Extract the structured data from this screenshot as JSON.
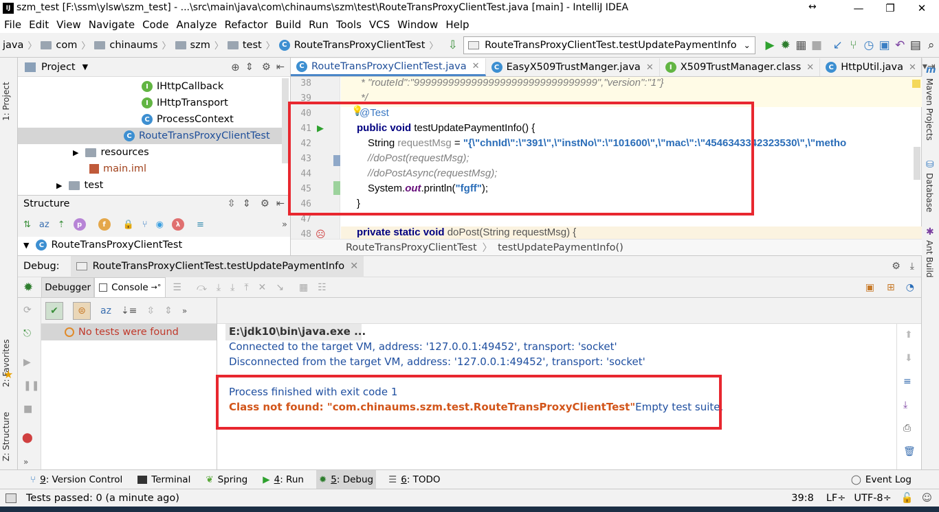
{
  "window": {
    "title": "szm_test [F:\\ssm\\ylsw\\szm_test] - ...\\src\\main\\java\\com\\chinaums\\szm\\test\\RouteTransProxyClientTest.java [main] - IntelliJ IDEA"
  },
  "menu": [
    "File",
    "Edit",
    "View",
    "Navigate",
    "Code",
    "Analyze",
    "Refactor",
    "Build",
    "Run",
    "Tools",
    "VCS",
    "Window",
    "Help"
  ],
  "breadcrumbs": [
    "java",
    "com",
    "chinaums",
    "szm",
    "test",
    "RouteTransProxyClientTest"
  ],
  "run_config": "RouteTransProxyClientTest.testUpdatePaymentInfo",
  "project": {
    "title": "Project",
    "items": [
      {
        "label": "IHttpCallback",
        "kind": "I"
      },
      {
        "label": "IHttpTransport",
        "kind": "I"
      },
      {
        "label": "ProcessContext",
        "kind": "C"
      },
      {
        "label": "RouteTransProxyClientTest",
        "kind": "C"
      },
      {
        "label": "resources",
        "kind": "folder"
      },
      {
        "label": "main.iml",
        "kind": "iml"
      },
      {
        "label": "test",
        "kind": "folder"
      }
    ]
  },
  "structure": {
    "title": "Structure",
    "root": "RouteTransProxyClientTest"
  },
  "editor": {
    "tabs": [
      {
        "label": "RouteTransProxyClientTest.java",
        "icon": "C"
      },
      {
        "label": "EasyX509TrustManger.java",
        "icon": "C"
      },
      {
        "label": "X509TrustManager.class",
        "icon": "I"
      },
      {
        "label": "HttpUtil.java",
        "icon": "C"
      }
    ],
    "line_numbers": [
      "38",
      "39",
      "40",
      "41",
      "42",
      "43",
      "44",
      "45",
      "46",
      "47",
      "48"
    ],
    "code": {
      "l38": "* \"routeId\":\"99999999999999999999999999999999\",\"version\":\"1\"}",
      "l39": "*/",
      "l40": "@Test",
      "l41_kw": "public void",
      "l41_rest": " testUpdatePaymentInfo() {",
      "l42_type": "String ",
      "l42_var": "requestMsg",
      "l42_eq": " = ",
      "l42_str": "\"{\\\"chnId\\\":\\\"391\\\",\\\"instNo\\\":\\\"101600\\\",\\\"mac\\\":\\\"4546343342323530\\\",\\\"metho",
      "l43": "//doPost(requestMsg);",
      "l44": "//doPostAsync(requestMsg);",
      "l45_a": "System.",
      "l45_b": "out",
      "l45_c": ".println(",
      "l45_d": "\"fgff\"",
      "l45_e": ");",
      "l46": "}",
      "l48_kw": "private static void",
      "l48_rest": " doPost(String requestMsg) {"
    },
    "breadcrumb": [
      "RouteTransProxyClientTest",
      "testUpdatePaymentInfo()"
    ]
  },
  "debug": {
    "label": "Debug:",
    "session": "RouteTransProxyClientTest.testUpdatePaymentInfo",
    "tabs": [
      "Debugger",
      "Console"
    ],
    "tests_status": "No tests were found",
    "console": {
      "cmd": "E:\\jdk10\\bin\\java.exe ...",
      "l1": "Connected to the target VM, address: '127.0.0.1:49452', transport: 'socket'",
      "l2": "Disconnected from the target VM, address: '127.0.0.1:49452', transport: 'socket'",
      "l3": "Process finished with exit code 1",
      "l4_err": "Class not found: \"com.chinaums.szm.test.RouteTransProxyClientTest\"",
      "l4_rest": "Empty test suite."
    }
  },
  "bottom_tabs": [
    {
      "key": "9",
      "label": ": Version Control"
    },
    {
      "key": "",
      "label": "Terminal"
    },
    {
      "key": "",
      "label": "Spring"
    },
    {
      "key": "4",
      "label": ": Run"
    },
    {
      "key": "5",
      "label": ": Debug"
    },
    {
      "key": "6",
      "label": ": TODO"
    }
  ],
  "event_log": "Event Log",
  "side": {
    "left": [
      "1: Project",
      "2: Favorites",
      "Z: Structure"
    ],
    "right": [
      "Maven Projects",
      "Database",
      "Ant Build"
    ]
  },
  "status": {
    "message": "Tests passed: 0 (a minute ago)",
    "position": "39:8",
    "line_sep": "LF÷",
    "encoding": "UTF-8÷"
  }
}
